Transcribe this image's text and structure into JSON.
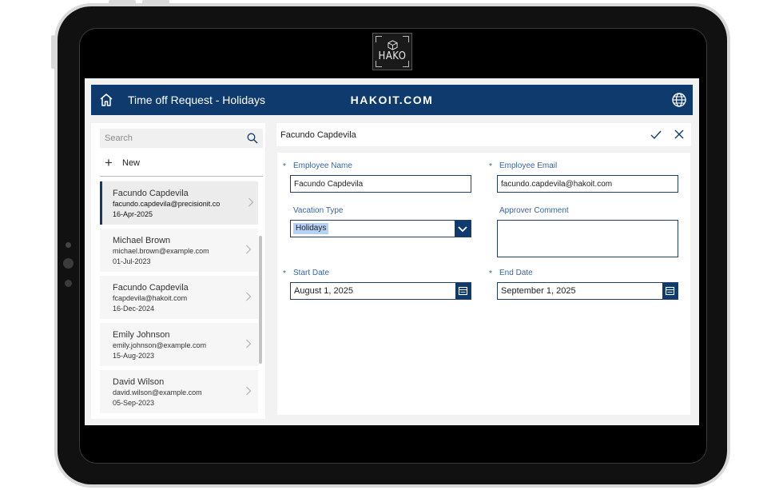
{
  "header": {
    "title": "Time off Request - Holidays",
    "brand": "HAKOIT.COM",
    "home_icon": "home-icon",
    "globe_icon": "globe-icon"
  },
  "logo": {
    "text": "HAKO"
  },
  "sidebar": {
    "search_placeholder": "Search",
    "new_label": "New",
    "items": [
      {
        "name": "Facundo Capdevila",
        "email": "facundo.capdevila@precisionit.co",
        "date": "16-Apr-2025",
        "selected": true
      },
      {
        "name": "Michael Brown",
        "email": "michael.brown@example.com",
        "date": "01-Jul-2023"
      },
      {
        "name": "Facundo Capdevila",
        "email": "fcapdevila@hakoit.com",
        "date": "16-Dec-2024"
      },
      {
        "name": "Emily Johnson",
        "email": "emily.johnson@example.com",
        "date": "15-Aug-2023"
      },
      {
        "name": "David Wilson",
        "email": "david.wilson@example.com",
        "date": "05-Sep-2023"
      }
    ]
  },
  "form": {
    "title": "Facundo Capdevila",
    "required_marker": "*",
    "employee_name": {
      "label": "Employee Name",
      "value": "Facundo Capdevila"
    },
    "employee_email": {
      "label": "Employee Email",
      "value": "facundo.capdevila@hakoit.com"
    },
    "vacation_type": {
      "label": "Vacation Type",
      "value": "Holidays"
    },
    "approver_comment": {
      "label": "Approver Comment",
      "value": ""
    },
    "start_date": {
      "label": "Start Date",
      "value": "August 1, 2025"
    },
    "end_date": {
      "label": "End Date",
      "value": "September 1, 2025"
    }
  },
  "colors": {
    "header_bg": "#0e3a6e",
    "label": "#3a66a0",
    "selection": "#b5d1f5"
  }
}
